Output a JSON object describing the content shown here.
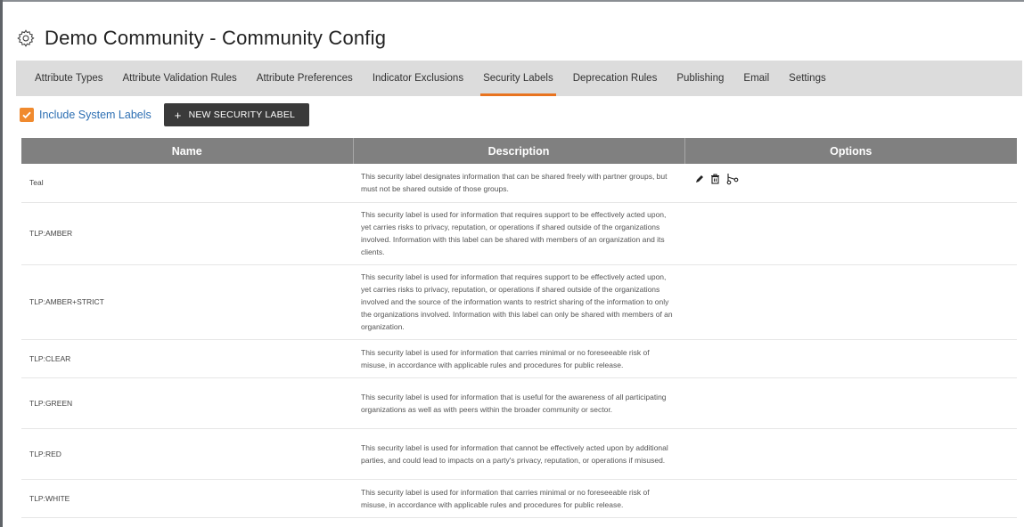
{
  "page": {
    "title": "Demo Community - Community Config"
  },
  "tabs": [
    {
      "label": "Attribute Types",
      "active": false
    },
    {
      "label": "Attribute Validation Rules",
      "active": false
    },
    {
      "label": "Attribute Preferences",
      "active": false
    },
    {
      "label": "Indicator Exclusions",
      "active": false
    },
    {
      "label": "Security Labels",
      "active": true
    },
    {
      "label": "Deprecation Rules",
      "active": false
    },
    {
      "label": "Publishing",
      "active": false
    },
    {
      "label": "Email",
      "active": false
    },
    {
      "label": "Settings",
      "active": false
    }
  ],
  "toolbar": {
    "include_system_labels": {
      "label": "Include System Labels",
      "checked": true
    },
    "new_button": {
      "icon": "plus-icon",
      "label": "NEW SECURITY LABEL"
    }
  },
  "table": {
    "columns": [
      "Name",
      "Description",
      "Options"
    ],
    "rows": [
      {
        "name": "Teal",
        "description": "This security label designates information that can be shared freely with partner groups, but must not be shared outside of those groups.",
        "options": [
          "edit-icon",
          "delete-icon",
          "scissors-icon"
        ]
      },
      {
        "name": "TLP:AMBER",
        "description": "This security label is used for information that requires support to be effectively acted upon, yet carries risks to privacy, reputation, or operations if shared outside of the organizations involved. Information with this label can be shared with members of an organization and its clients.",
        "options": []
      },
      {
        "name": "TLP:AMBER+STRICT",
        "description": "This security label is used for information that requires support to be effectively acted upon, yet carries risks to privacy, reputation, or operations if shared outside of the organizations involved and the source of the information wants to restrict sharing of the information to only the organizations involved. Information with this label can only be shared with members of an organization.",
        "options": []
      },
      {
        "name": "TLP:CLEAR",
        "description": "This security label is used for information that carries minimal or no foreseeable risk of misuse, in accordance with applicable rules and procedures for public release.",
        "options": []
      },
      {
        "name": "TLP:GREEN",
        "description": "This security label is used for information that is useful for the awareness of all participating organizations as well as with peers within the broader community or sector.",
        "options": []
      },
      {
        "name": "TLP:RED",
        "description": "This security label is used for information that cannot be effectively acted upon by additional parties, and could lead to impacts on a party's privacy, reputation, or operations if misused.",
        "options": []
      },
      {
        "name": "TLP:WHITE",
        "description": "This security label is used for information that carries minimal or no foreseeable risk of misuse, in accordance with applicable rules and procedures for public release.",
        "options": []
      }
    ]
  },
  "colors": {
    "accent": "#e8731f",
    "checkbox": "#f08a2e",
    "link": "#2d6fb3",
    "header_bg": "#808080",
    "tabbar_bg": "#dcdcdc",
    "button_bg": "#3a3a3a"
  }
}
